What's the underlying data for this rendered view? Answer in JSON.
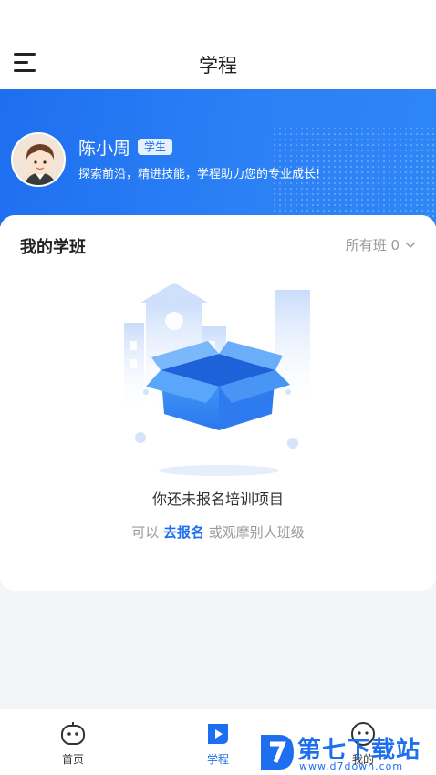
{
  "header": {
    "title": "学程"
  },
  "profile": {
    "name": "陈小周",
    "role_badge": "学生",
    "slogan": "探索前沿，精进技能，学程助力您的专业成长!"
  },
  "classes": {
    "title": "我的学班",
    "filter_label": "所有班 0",
    "empty_title": "你还未报名培训项目",
    "hint_prefix": "可以",
    "hint_link": "去报名",
    "hint_suffix": "或观摩别人班级"
  },
  "tabs": [
    {
      "label": "首页",
      "icon": "home-robot-icon"
    },
    {
      "label": "学程",
      "icon": "play-icon"
    },
    {
      "label": "我的",
      "icon": "profile-icon"
    }
  ],
  "active_tab": "学程",
  "watermark": {
    "text": "第七下载站",
    "url": "www.d7down.com"
  },
  "colors": {
    "accent": "#1e6ff0",
    "banner": "#2b80f5",
    "muted": "#9a9a9a"
  }
}
